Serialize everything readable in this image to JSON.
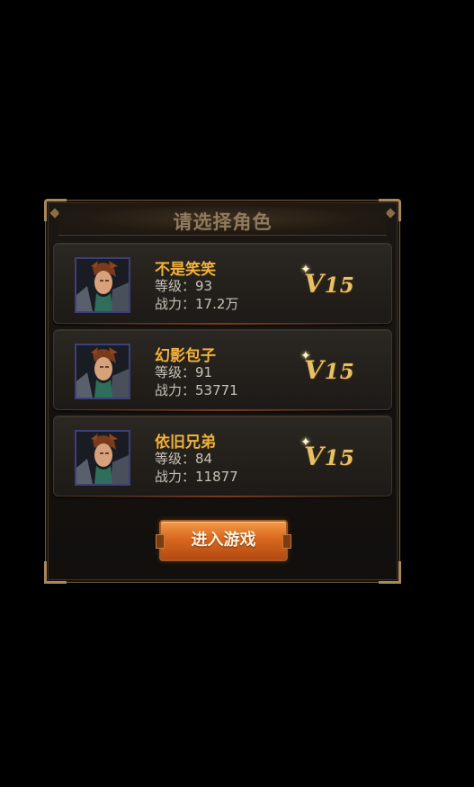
{
  "dialog": {
    "title": "请选择角色",
    "enter_button": "进入游戏"
  },
  "characters": [
    {
      "name": "不是笑笑",
      "level_text": "等级：93",
      "power_text": "战力：17.2万",
      "vip_prefix": "V",
      "vip_level": "15"
    },
    {
      "name": "幻影包子",
      "level_text": "等级：91",
      "power_text": "战力：53771",
      "vip_prefix": "V",
      "vip_level": "15"
    },
    {
      "name": "依旧兄弟",
      "level_text": "等级：84",
      "power_text": "战力：11877",
      "vip_prefix": "V",
      "vip_level": "15"
    }
  ],
  "colors": {
    "name": "#f2b23a",
    "stat": "#c8c2b6",
    "vip": "#e6c16a",
    "button": "#d9681f",
    "title": "#8f7a5d"
  },
  "icons": {
    "avatar": "warrior-portrait-icon",
    "vip_sparkle": "sparkle-icon"
  }
}
